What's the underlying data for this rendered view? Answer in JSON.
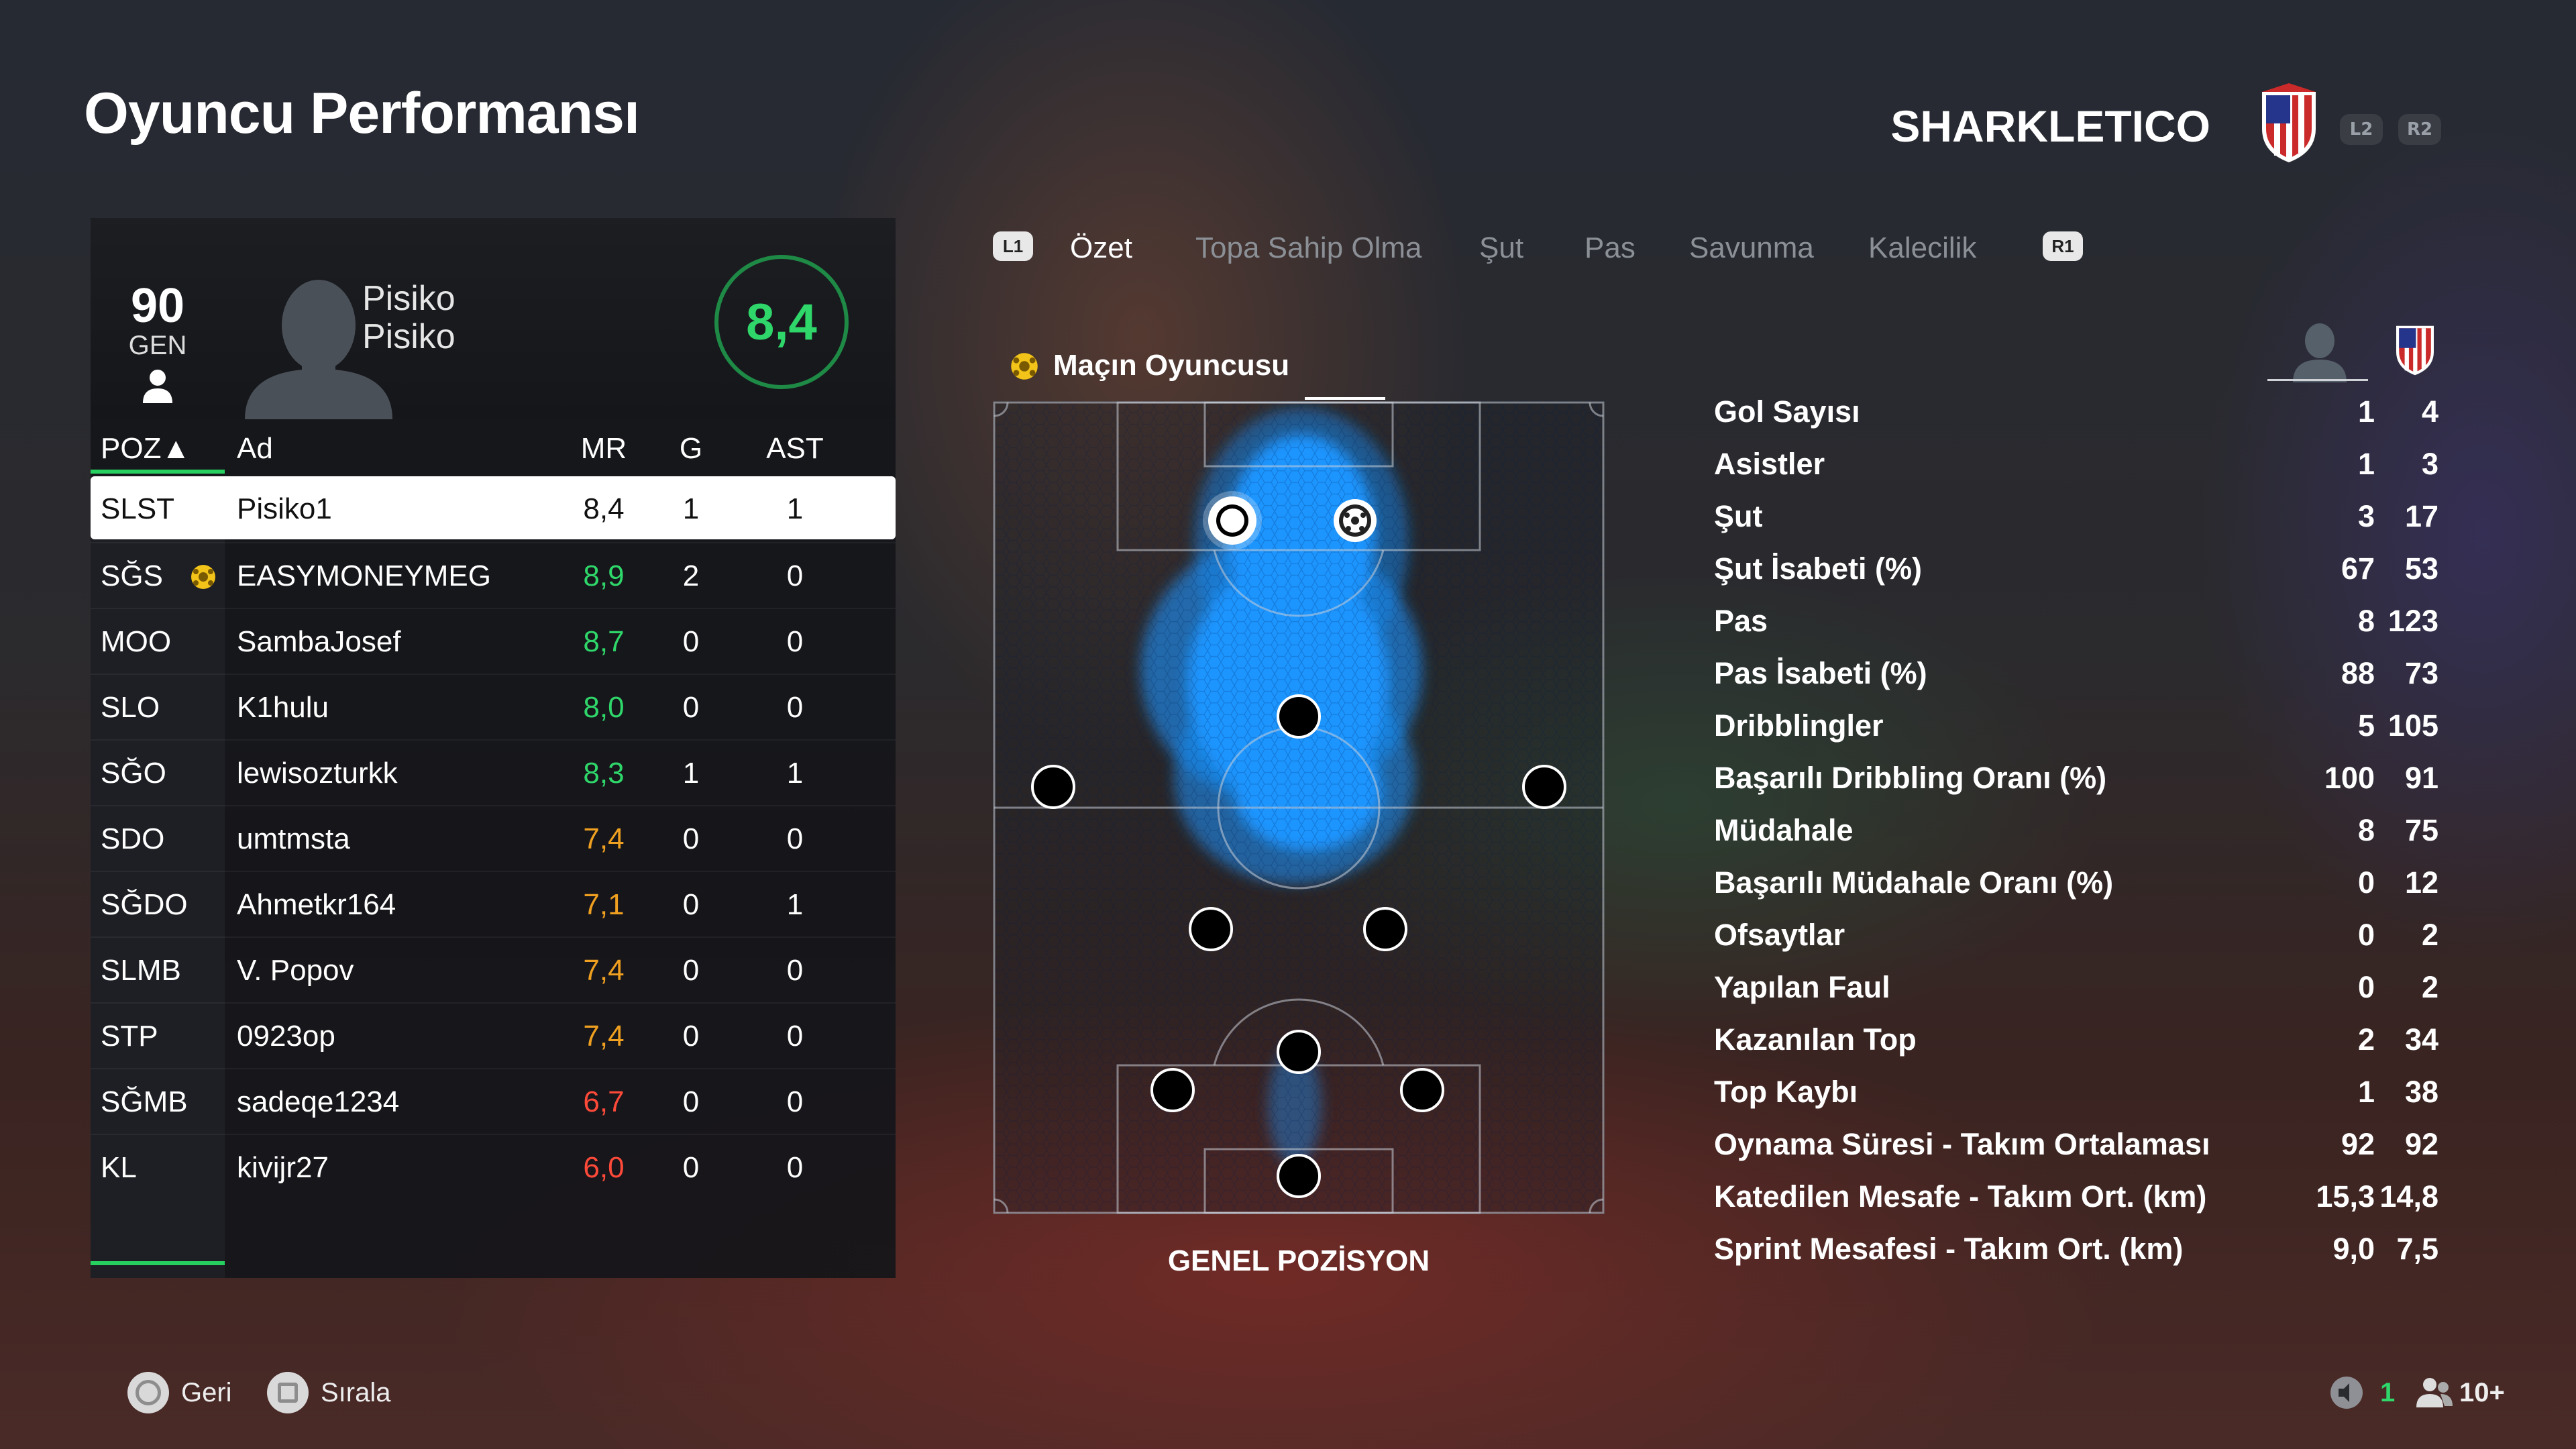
{
  "header": {
    "title": "Oyuncu Performansı",
    "team_name": "SHARKLETICO",
    "l2": "L2",
    "r2": "R2"
  },
  "colors": {
    "accent_green": "#26d05f",
    "rating_green": "#2fd76a",
    "rating_orange": "#f0a020",
    "rating_red": "#ff4a3a",
    "heat_blue": "#1e90ff"
  },
  "player_card": {
    "overall": "90",
    "overall_label": "GEN",
    "first_name": "Pisiko",
    "last_name": "Pisiko",
    "rating": "8,4"
  },
  "table": {
    "headers": {
      "pos": "POZ▲",
      "name": "Ad",
      "mr": "MR",
      "g": "G",
      "ast": "AST"
    },
    "rows": [
      {
        "pos": "SLST",
        "name": "Pisiko1",
        "mr": "8,4",
        "g": "1",
        "ast": "1",
        "selected": true
      },
      {
        "pos": "SĞS",
        "name": "EASYMONEYMEG",
        "mr": "8,9",
        "g": "2",
        "ast": "0",
        "motm": true
      },
      {
        "pos": "MOO",
        "name": "SambaJosef",
        "mr": "8,7",
        "g": "0",
        "ast": "0"
      },
      {
        "pos": "SLO",
        "name": "K1hulu",
        "mr": "8,0",
        "g": "0",
        "ast": "0"
      },
      {
        "pos": "SĞO",
        "name": "lewisozturkk",
        "mr": "8,3",
        "g": "1",
        "ast": "1"
      },
      {
        "pos": "SDO",
        "name": "umtmsta",
        "mr": "7,4",
        "g": "0",
        "ast": "0"
      },
      {
        "pos": "SĞDO",
        "name": "Ahmetkr164",
        "mr": "7,1",
        "g": "0",
        "ast": "1"
      },
      {
        "pos": "SLMB",
        "name": "V. Popov",
        "mr": "7,4",
        "g": "0",
        "ast": "0"
      },
      {
        "pos": "STP",
        "name": "0923op",
        "mr": "7,4",
        "g": "0",
        "ast": "0"
      },
      {
        "pos": "SĞMB",
        "name": "sadeqe1234",
        "mr": "6,7",
        "g": "0",
        "ast": "0"
      },
      {
        "pos": "KL",
        "name": "kivijr27",
        "mr": "6,0",
        "g": "0",
        "ast": "0"
      }
    ]
  },
  "tabs": {
    "l1": "L1",
    "r1": "R1",
    "items": [
      "Özet",
      "Topa Sahip Olma",
      "Şut",
      "Pas",
      "Savunma",
      "Kalecilik"
    ],
    "active": "Özet"
  },
  "motm_label": "Maçın Oyuncusu",
  "pitch_label": "GENEL POZİSYON",
  "stats": [
    {
      "label": "Gol Sayısı",
      "player": "1",
      "team": "4"
    },
    {
      "label": "Asistler",
      "player": "1",
      "team": "3"
    },
    {
      "label": "Şut",
      "player": "3",
      "team": "17"
    },
    {
      "label": "Şut İsabeti (%)",
      "player": "67",
      "team": "53"
    },
    {
      "label": "Pas",
      "player": "8",
      "team": "123"
    },
    {
      "label": "Pas İsabeti (%)",
      "player": "88",
      "team": "73"
    },
    {
      "label": "Dribblingler",
      "player": "5",
      "team": "105"
    },
    {
      "label": "Başarılı Dribbling Oranı (%)",
      "player": "100",
      "team": "91"
    },
    {
      "label": "Müdahale",
      "player": "8",
      "team": "75"
    },
    {
      "label": "Başarılı Müdahale Oranı (%)",
      "player": "0",
      "team": "12"
    },
    {
      "label": "Ofsaytlar",
      "player": "0",
      "team": "2"
    },
    {
      "label": "Yapılan Faul",
      "player": "0",
      "team": "2"
    },
    {
      "label": "Kazanılan Top",
      "player": "2",
      "team": "34"
    },
    {
      "label": "Top Kaybı",
      "player": "1",
      "team": "38"
    },
    {
      "label": "Oynama Süresi - Takım Ortalaması",
      "player": "92",
      "team": "92"
    },
    {
      "label": "Katedilen Mesafe - Takım Ort. (km)",
      "player": "15,3",
      "team": "14,8"
    },
    {
      "label": "Sprint Mesafesi - Takım Ort. (km)",
      "player": "9,0",
      "team": "7,5"
    }
  ],
  "footer": {
    "back": "Geri",
    "sort": "Sırala",
    "mic_count": "1",
    "players": "10+"
  }
}
